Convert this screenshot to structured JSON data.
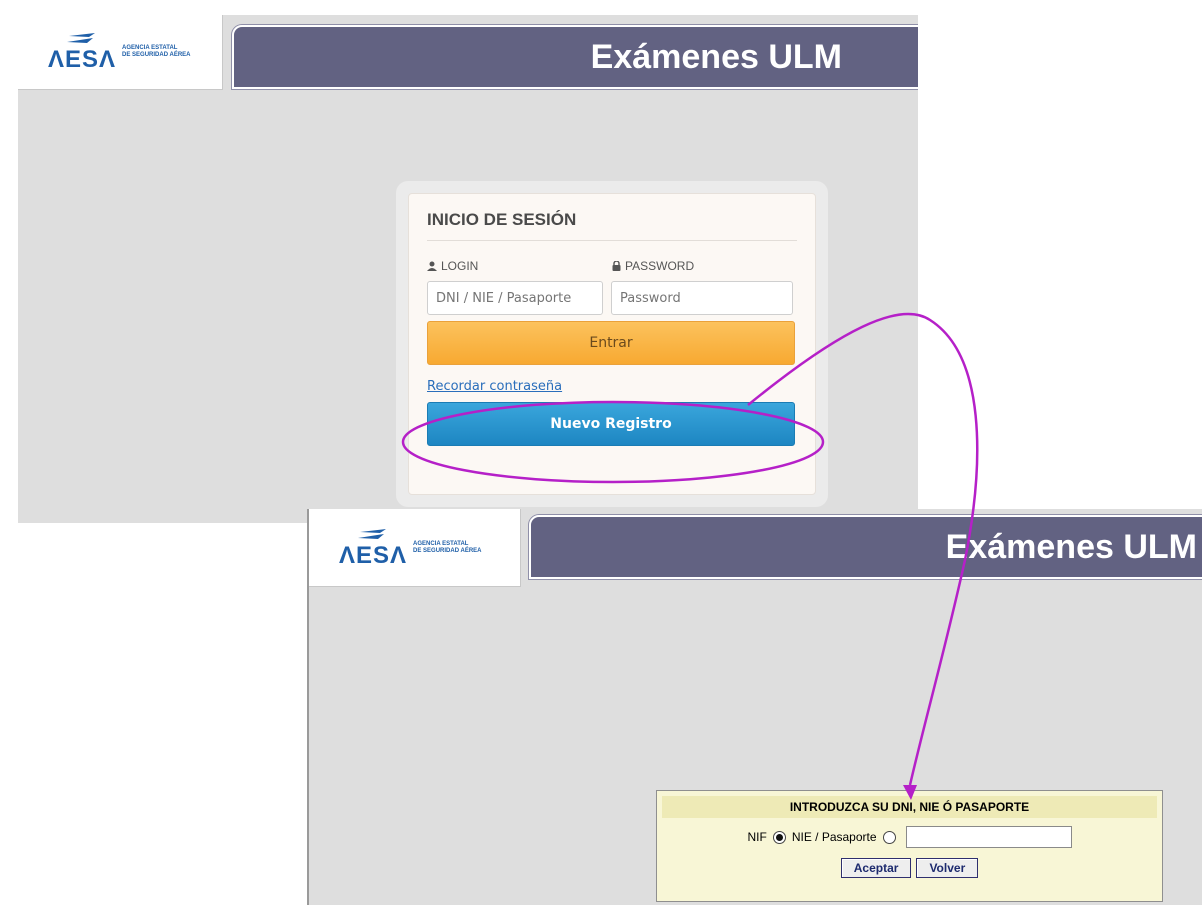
{
  "top_screen": {
    "header": {
      "logo_word": "ΛESΛ",
      "logo_line1": "AGENCIA ESTATAL",
      "logo_line2": "DE SEGURIDAD AÉREA",
      "title": "Exámenes ULM"
    },
    "login": {
      "heading": "INICIO DE SESIÓN",
      "login_label": "LOGIN",
      "password_label": "PASSWORD",
      "login_placeholder": "DNI / NIE / Pasaporte",
      "password_placeholder": "Password",
      "submit_label": "Entrar",
      "remember_link": "Recordar contraseña",
      "register_label": "Nuevo Registro"
    }
  },
  "bottom_screen": {
    "header": {
      "logo_word": "ΛESΛ",
      "logo_line1": "AGENCIA ESTATAL",
      "logo_line2": "DE SEGURIDAD AÉREA",
      "title": "Exámenes ULM"
    },
    "dni_form": {
      "title": "INTRODUZCA SU DNI, NIE Ó PASAPORTE",
      "option_nif": "NIF",
      "option_nie": "NIE / Pasaporte",
      "selected": "NIF",
      "value": "",
      "accept_label": "Aceptar",
      "back_label": "Volver"
    }
  },
  "colors": {
    "header_bar": "#626282",
    "page_bg": "#dedede",
    "entrar_button": "#f7a931",
    "registro_button": "#1d86c2",
    "annotation": "#b520c8"
  }
}
